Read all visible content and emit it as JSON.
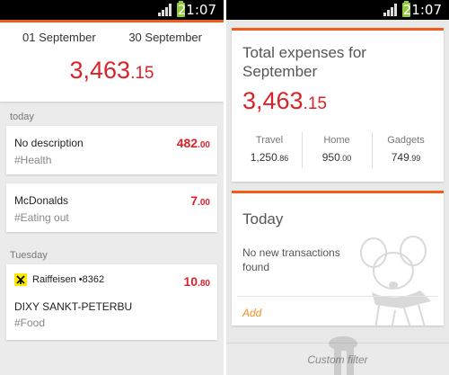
{
  "status_bar": {
    "time": "21:07"
  },
  "period": {
    "from": "01 September",
    "to": "30 September",
    "total_int": "3,463",
    "total_dec": ".15"
  },
  "groups": [
    {
      "label": "today"
    },
    {
      "label": "Tuesday"
    }
  ],
  "transactions": [
    {
      "title": "No description",
      "category": "#Health",
      "amount_int": "482",
      "amount_dec": ".00"
    },
    {
      "title": "McDonalds",
      "category": "#Eating out",
      "amount_int": "7",
      "amount_dec": ".00"
    },
    {
      "bank": "Raiffeisen •8362",
      "title": "DIXY SANKT-PETERBU",
      "category": "#Food",
      "amount_int": "10",
      "amount_dec": ".80"
    }
  ],
  "summary": {
    "title": "Total expenses for September",
    "total_int": "3,463",
    "total_dec": ".15",
    "categories": [
      {
        "name": "Travel",
        "int": "1,250",
        "dec": ".86"
      },
      {
        "name": "Home",
        "int": "950",
        "dec": ".00"
      },
      {
        "name": "Gadgets",
        "int": "749",
        "dec": ".99"
      }
    ]
  },
  "today_card": {
    "title": "Today",
    "empty_message": "No new transactions found",
    "add_label": "Add"
  },
  "footer": {
    "custom_filter_label": "Custom filter"
  },
  "colors": {
    "accent": "#f25c1a",
    "amount": "#d8232a",
    "add_link": "#f39021",
    "battery": "#92c93a",
    "bank_logo": "#fde900"
  },
  "icons": {
    "signal": "signal-icon",
    "battery": "battery-icon",
    "bank": "raiffeisen-logo-icon",
    "mascot": "mascot-illustration"
  }
}
